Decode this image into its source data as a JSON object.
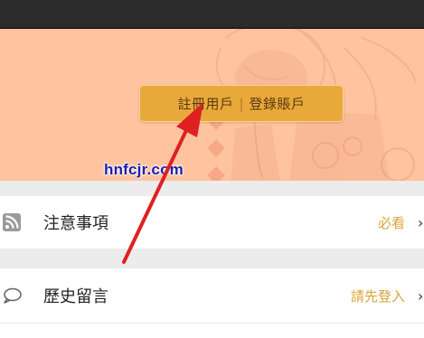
{
  "auth": {
    "register_label": "註冊用戶",
    "separator": "|",
    "login_label": "登錄賬戶"
  },
  "watermark": "hnfcjr.com",
  "menu": [
    {
      "label": "注意事項",
      "action": "必看",
      "chevron": "›",
      "icon": "rss-icon"
    },
    {
      "label": "歷史留言",
      "action": "請先登入",
      "chevron": "›",
      "icon": "chat-bubble-icon"
    }
  ],
  "colors": {
    "hero_bg": "#ffc3a0",
    "button_bg": "#e9a93a",
    "accent_text": "#d9a43b",
    "annotation_arrow": "#e02020",
    "watermark": "#1a1fb0"
  }
}
